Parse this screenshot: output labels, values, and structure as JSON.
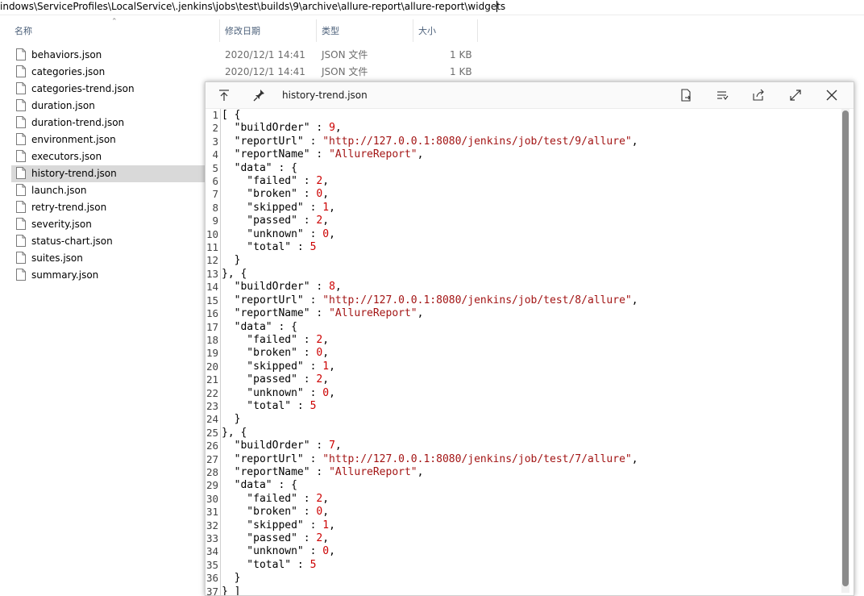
{
  "address": {
    "path": "indows\\ServiceProfiles\\LocalService\\.jenkins\\jobs\\test\\builds\\9\\archive\\allure-report\\allure-report\\widgets"
  },
  "columns": {
    "name": "名称",
    "modified": "修改日期",
    "type": "类型",
    "size": "大小"
  },
  "files": [
    {
      "name": "behaviors.json",
      "modified": "2020/12/1 14:41",
      "type": "JSON 文件",
      "size": "1 KB"
    },
    {
      "name": "categories.json",
      "modified": "2020/12/1 14:41",
      "type": "JSON 文件",
      "size": "1 KB"
    },
    {
      "name": "categories-trend.json"
    },
    {
      "name": "duration.json"
    },
    {
      "name": "duration-trend.json"
    },
    {
      "name": "environment.json"
    },
    {
      "name": "executors.json"
    },
    {
      "name": "history-trend.json",
      "selected": true
    },
    {
      "name": "launch.json"
    },
    {
      "name": "retry-trend.json"
    },
    {
      "name": "severity.json"
    },
    {
      "name": "status-chart.json"
    },
    {
      "name": "suites.json"
    },
    {
      "name": "summary.json"
    }
  ],
  "preview": {
    "title": "history-trend.json",
    "toolbar_icons": [
      "pin-top-icon",
      "pin-icon",
      "open-file-icon",
      "list-icon",
      "share-icon",
      "expand-icon",
      "close-icon"
    ],
    "lines": [
      {
        "no": "1",
        "text": "[ {"
      },
      {
        "no": "2",
        "text": "  \"buildOrder\" : 9,"
      },
      {
        "no": "3",
        "text": "  \"reportUrl\" : \"http://127.0.0.1:8080/jenkins/job/test/9/allure\","
      },
      {
        "no": "4",
        "text": "  \"reportName\" : \"AllureReport\","
      },
      {
        "no": "5",
        "text": "  \"data\" : {"
      },
      {
        "no": "6",
        "text": "    \"failed\" : 2,"
      },
      {
        "no": "7",
        "text": "    \"broken\" : 0,"
      },
      {
        "no": "8",
        "text": "    \"skipped\" : 1,"
      },
      {
        "no": "9",
        "text": "    \"passed\" : 2,"
      },
      {
        "no": "10",
        "text": "    \"unknown\" : 0,"
      },
      {
        "no": "11",
        "text": "    \"total\" : 5"
      },
      {
        "no": "12",
        "text": "  }"
      },
      {
        "no": "13",
        "text": "}, {"
      },
      {
        "no": "14",
        "text": "  \"buildOrder\" : 8,"
      },
      {
        "no": "15",
        "text": "  \"reportUrl\" : \"http://127.0.0.1:8080/jenkins/job/test/8/allure\","
      },
      {
        "no": "16",
        "text": "  \"reportName\" : \"AllureReport\","
      },
      {
        "no": "17",
        "text": "  \"data\" : {"
      },
      {
        "no": "18",
        "text": "    \"failed\" : 2,"
      },
      {
        "no": "19",
        "text": "    \"broken\" : 0,"
      },
      {
        "no": "20",
        "text": "    \"skipped\" : 1,"
      },
      {
        "no": "21",
        "text": "    \"passed\" : 2,"
      },
      {
        "no": "22",
        "text": "    \"unknown\" : 0,"
      },
      {
        "no": "23",
        "text": "    \"total\" : 5"
      },
      {
        "no": "24",
        "text": "  }"
      },
      {
        "no": "25",
        "text": "}, {"
      },
      {
        "no": "26",
        "text": "  \"buildOrder\" : 7,"
      },
      {
        "no": "27",
        "text": "  \"reportUrl\" : \"http://127.0.0.1:8080/jenkins/job/test/7/allure\","
      },
      {
        "no": "28",
        "text": "  \"reportName\" : \"AllureReport\","
      },
      {
        "no": "29",
        "text": "  \"data\" : {"
      },
      {
        "no": "30",
        "text": "    \"failed\" : 2,"
      },
      {
        "no": "31",
        "text": "    \"broken\" : 0,"
      },
      {
        "no": "32",
        "text": "    \"skipped\" : 1,"
      },
      {
        "no": "33",
        "text": "    \"passed\" : 2,"
      },
      {
        "no": "34",
        "text": "    \"unknown\" : 0,"
      },
      {
        "no": "35",
        "text": "    \"total\" : 5"
      },
      {
        "no": "36",
        "text": "  }"
      },
      {
        "no": "37",
        "text": "} ]"
      }
    ]
  },
  "colors": {
    "selection": "#d9d9d9",
    "string": "#a31515",
    "number": "#cc0000",
    "header_text": "#4c607a"
  }
}
